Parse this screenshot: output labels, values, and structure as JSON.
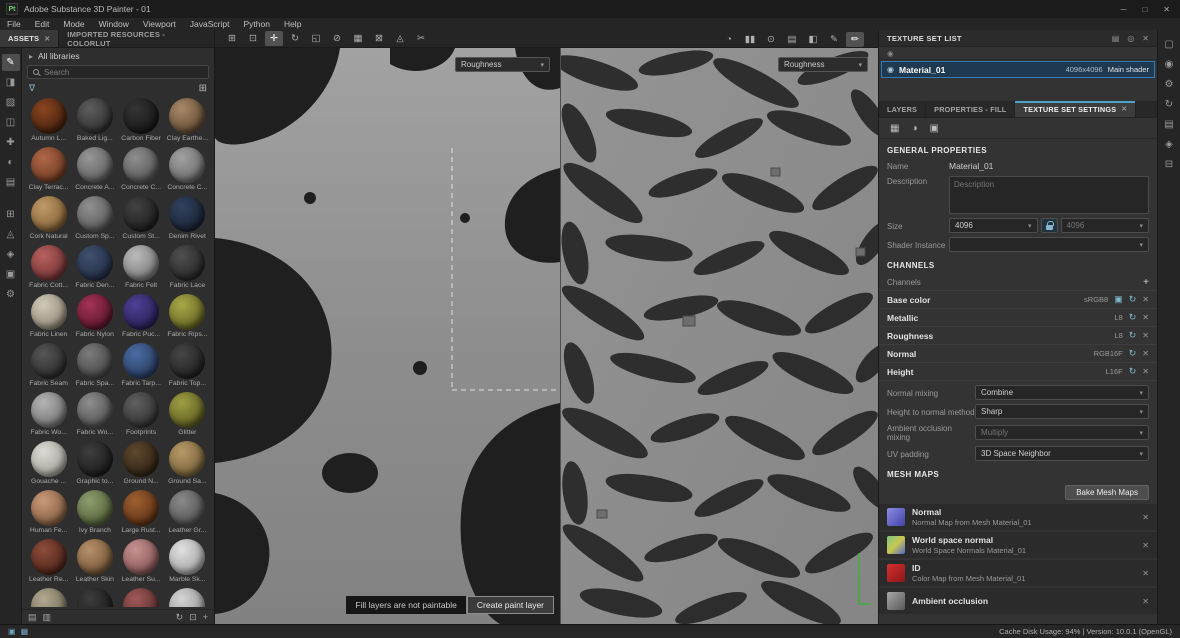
{
  "window": {
    "logo": "Pt",
    "title": "Adobe Substance 3D Painter - 01",
    "controls": {
      "minimize": "─",
      "maximize": "□",
      "close": "✕"
    }
  },
  "menubar": [
    "File",
    "Edit",
    "Mode",
    "Window",
    "Viewport",
    "JavaScript",
    "Python",
    "Help"
  ],
  "doc_tabs": {
    "assets": "ASSETS",
    "assets_close": "✕",
    "imported": "IMPORTED RESOURCES - COLORLUT"
  },
  "icons": {
    "chevron_right": "▸",
    "funnel": "∇",
    "grid_view": "⊞",
    "dropdown_arrow": "▾",
    "eye": "◉",
    "close": "✕",
    "add": "+",
    "reset": "↻",
    "texture": "▣",
    "pin": "◎",
    "menu": "▤"
  },
  "toolbar": {
    "left_icons": [
      {
        "name": "gizmo-translate-icon",
        "glyph": "⊞"
      },
      {
        "name": "gizmo-rotate-icon",
        "glyph": "⊡"
      },
      {
        "name": "move-tool-icon",
        "glyph": "✛",
        "active": true
      },
      {
        "name": "rotate-tool-icon",
        "glyph": "↻"
      },
      {
        "name": "scale-tool-icon",
        "glyph": "◱"
      },
      {
        "name": "snap-icon",
        "glyph": "⊘"
      },
      {
        "name": "grid-icon",
        "glyph": "▦"
      },
      {
        "name": "quick-mask-icon",
        "glyph": "⊠"
      },
      {
        "name": "stencil-icon",
        "glyph": "◬"
      },
      {
        "name": "lasso-icon",
        "glyph": "✂"
      }
    ],
    "right_icons": [
      {
        "name": "rotate-view-icon",
        "glyph": "◔"
      },
      {
        "name": "pause-engine-icon",
        "glyph": "▮▮"
      },
      {
        "name": "screenshot-camera-icon",
        "glyph": "⊙"
      },
      {
        "name": "display-mode-icon",
        "glyph": "▤"
      },
      {
        "name": "camera-record-icon",
        "glyph": "◧"
      },
      {
        "name": "physical-paint-icon",
        "glyph": "✎"
      },
      {
        "name": "brush-tool-icon",
        "glyph": "✏",
        "active": true
      }
    ]
  },
  "toolstrip": [
    {
      "name": "paint-tool-icon",
      "glyph": "✎",
      "active": true
    },
    {
      "name": "eraser-tool-icon",
      "glyph": "◨"
    },
    {
      "name": "projection-tool-icon",
      "glyph": "▨"
    },
    {
      "name": "polygon-fill-icon",
      "glyph": "◫"
    },
    {
      "name": "smudge-tool-icon",
      "glyph": "✚"
    },
    {
      "name": "clone-tool-icon",
      "glyph": "◐"
    },
    {
      "name": "material-picker-icon",
      "glyph": "▤"
    },
    {
      "name": "quick-mask-toggle-icon",
      "glyph": "⊞",
      "gap": true
    },
    {
      "name": "path-tool-icon",
      "glyph": "◬"
    },
    {
      "name": "effects-icon",
      "glyph": "◈"
    },
    {
      "name": "export-icon",
      "glyph": "▣"
    },
    {
      "name": "tool-settings-icon",
      "glyph": "⚙"
    }
  ],
  "assets": {
    "all_libraries_label": "All libraries",
    "search_placeholder": "Search",
    "footer_left": [
      {
        "name": "list-view-icon",
        "glyph": "▤"
      },
      {
        "name": "thumbnail-view-icon",
        "glyph": "▥"
      }
    ],
    "footer_right": [
      {
        "name": "refresh-assets-icon",
        "glyph": "↻"
      },
      {
        "name": "expand-panel-icon",
        "glyph": "⊡"
      },
      {
        "name": "add-asset-icon",
        "glyph": "+"
      }
    ],
    "items": [
      {
        "label": "Autumn L...",
        "hi": "#8a4520",
        "lo": "#2e1608"
      },
      {
        "label": "Baked Lig...",
        "hi": "#5e5e5e",
        "lo": "#1e1e1e"
      },
      {
        "label": "Carbon Fiber",
        "hi": "#343434",
        "lo": "#0e0e0e"
      },
      {
        "label": "Clay Earthe...",
        "hi": "#a8896a",
        "lo": "#4e3822"
      },
      {
        "label": "Clay Terrac...",
        "hi": "#b06848",
        "lo": "#5a2c16"
      },
      {
        "label": "Concrete A...",
        "hi": "#969696",
        "lo": "#4e4e4e"
      },
      {
        "label": "Concrete C...",
        "hi": "#8e8e8e",
        "lo": "#454545"
      },
      {
        "label": "Concrete C...",
        "hi": "#a2a2a2",
        "lo": "#585858"
      },
      {
        "label": "Cork Natural",
        "hi": "#c09a68",
        "lo": "#6e4e26"
      },
      {
        "label": "Custom Sp...",
        "hi": "#909090",
        "lo": "#484848"
      },
      {
        "label": "Custom St...",
        "hi": "#424242",
        "lo": "#121212"
      },
      {
        "label": "Denim Rivet",
        "hi": "#32425e",
        "lo": "#101826"
      },
      {
        "label": "Fabric Cott...",
        "hi": "#b86060",
        "lo": "#5c2424"
      },
      {
        "label": "Fabric Den...",
        "hi": "#40506e",
        "lo": "#182136"
      },
      {
        "label": "Fabric Felt",
        "hi": "#bcbcbc",
        "lo": "#636363"
      },
      {
        "label": "Fabric Lace",
        "hi": "#505050",
        "lo": "#181818"
      },
      {
        "label": "Fabric Linen",
        "hi": "#d0c9b9",
        "lo": "#7e7462"
      },
      {
        "label": "Fabric Nylon",
        "hi": "#a43254",
        "lo": "#440e20"
      },
      {
        "label": "Fabric Puc...",
        "hi": "#4e4096",
        "lo": "#1c1540"
      },
      {
        "label": "Fabric Rips...",
        "hi": "#a8a848",
        "lo": "#4e4e18"
      },
      {
        "label": "Fabric Seam",
        "hi": "#565656",
        "lo": "#1c1c1c"
      },
      {
        "label": "Fabric Spa...",
        "hi": "#7c7c7c",
        "lo": "#323232"
      },
      {
        "label": "Fabric Tarp...",
        "hi": "#4c6ca4",
        "lo": "#1c2c4a"
      },
      {
        "label": "Fabric Top...",
        "hi": "#464646",
        "lo": "#141414"
      },
      {
        "label": "Fabric Wo...",
        "hi": "#b4b4b4",
        "lo": "#5e5e5e"
      },
      {
        "label": "Fabric Wo...",
        "hi": "#8e8e8e",
        "lo": "#3c3c3c"
      },
      {
        "label": "Footprints",
        "hi": "#606060",
        "lo": "#222222"
      },
      {
        "label": "Glitter",
        "hi": "#9e9e44",
        "lo": "#484815"
      },
      {
        "label": "Gouache ...",
        "hi": "#dcdcd4",
        "lo": "#8c8c84"
      },
      {
        "label": "Graphic to...",
        "hi": "#3e3e3e",
        "lo": "#101010"
      },
      {
        "label": "Ground N...",
        "hi": "#5e482e",
        "lo": "#20160a"
      },
      {
        "label": "Ground Sa...",
        "hi": "#b89a68",
        "lo": "#604c28"
      },
      {
        "label": "Human Fe...",
        "hi": "#c89a78",
        "lo": "#6e4a30"
      },
      {
        "label": "Ivy Branch",
        "hi": "#8e9e6e",
        "lo": "#3e4c26"
      },
      {
        "label": "Large Rust...",
        "hi": "#a06030",
        "lo": "#46220c"
      },
      {
        "label": "Leather Gr...",
        "hi": "#8a8a8a",
        "lo": "#3e3e3e"
      },
      {
        "label": "Leather Re...",
        "hi": "#8e4c3c",
        "lo": "#38180e"
      },
      {
        "label": "Leather Skin",
        "hi": "#b8906a",
        "lo": "#5c4226"
      },
      {
        "label": "Leather Su...",
        "hi": "#c89292",
        "lo": "#6e4040"
      },
      {
        "label": "Marble Sk...",
        "hi": "#e0e0e0",
        "lo": "#909090"
      },
      {
        "label": "",
        "hi": "#b0a890",
        "lo": "#645e4c"
      },
      {
        "label": "",
        "hi": "#3c3c3c",
        "lo": "#121212"
      },
      {
        "label": "",
        "hi": "#a05858",
        "lo": "#4a2222"
      },
      {
        "label": "",
        "hi": "#d4d4d4",
        "lo": "#828282"
      }
    ]
  },
  "viewport3d": {
    "channel_selector": "Roughness"
  },
  "viewport2d": {
    "channel_selector": "Roughness"
  },
  "hint": {
    "message": "Fill layers are not paintable",
    "button_label": "Create paint layer"
  },
  "texture_set_list": {
    "title": "TEXTURE SET LIST",
    "material_name": "Material_01",
    "resolution": "4096x4096",
    "shader_label": "Main shader"
  },
  "panel_tabs": {
    "layers": "LAYERS",
    "properties": "PROPERTIES - FILL",
    "settings": "TEXTURE SET SETTINGS"
  },
  "settings": {
    "icon_row": [
      {
        "name": "grid-settings-icon",
        "glyph": "▦"
      },
      {
        "name": "material-sphere-icon",
        "glyph": "◑"
      },
      {
        "name": "stamp-icon",
        "glyph": "▣"
      }
    ],
    "general_title": "GENERAL PROPERTIES",
    "name_label": "Name",
    "name_value": "Material_01",
    "description_label": "Description",
    "description_placeholder": "Description",
    "size_label": "Size",
    "size_width": "4096",
    "size_height": "4096",
    "shader_instance_label": "Shader Instance",
    "channels_title": "CHANNELS",
    "channels_label": "Channels",
    "channels": [
      {
        "name": "Base color",
        "format": "sRGB8",
        "extra": true
      },
      {
        "name": "Metallic",
        "format": "L8"
      },
      {
        "name": "Roughness",
        "format": "L8"
      },
      {
        "name": "Normal",
        "format": "RGB16F"
      },
      {
        "name": "Height",
        "format": "L16F"
      }
    ],
    "normal_mixing_label": "Normal mixing",
    "normal_mixing_value": "Combine",
    "height_to_normal_label": "Height to normal method",
    "height_to_normal_value": "Sharp",
    "ao_mixing_label": "Ambient occlusion mixing",
    "ao_mixing_value": "Multiply",
    "uv_padding_label": "UV padding",
    "uv_padding_value": "3D Space Neighbor",
    "mesh_maps_title": "MESH MAPS",
    "bake_button_label": "Bake Mesh Maps",
    "mesh_maps": [
      {
        "name": "Normal",
        "desc": "Normal Map from Mesh Material_01",
        "thumb": [
          "#8c8ce4",
          "#4242a6"
        ]
      },
      {
        "name": "World space normal",
        "desc": "World Space Normals Material_01",
        "thumb": [
          "#7ec87e",
          "#c8c850",
          "#5064c8"
        ]
      },
      {
        "name": "ID",
        "desc": "Color Map from Mesh Material_01",
        "thumb": [
          "#d43030",
          "#8e1616"
        ]
      },
      {
        "name": "Ambient occlusion",
        "desc": "",
        "thumb": [
          "#a8a8a8",
          "#585858"
        ]
      }
    ]
  },
  "rightstrip": [
    {
      "name": "display-settings-icon",
      "glyph": "▢"
    },
    {
      "name": "camera-settings-icon",
      "glyph": "◉"
    },
    {
      "name": "shader-settings-icon",
      "glyph": "⚙"
    },
    {
      "name": "history-icon",
      "glyph": "↻"
    },
    {
      "name": "log-icon",
      "glyph": "▤"
    },
    {
      "name": "resources-icon",
      "glyph": "◈"
    },
    {
      "name": "collapse-panel-icon",
      "glyph": "⊟"
    }
  ],
  "statusbar": {
    "icons": [
      {
        "name": "shelf-status-icon",
        "glyph": "▣"
      },
      {
        "name": "script-status-icon",
        "glyph": "▦"
      }
    ],
    "text": "Cache Disk Usage: 94% | Version: 10.0.1 (OpenGL)"
  }
}
